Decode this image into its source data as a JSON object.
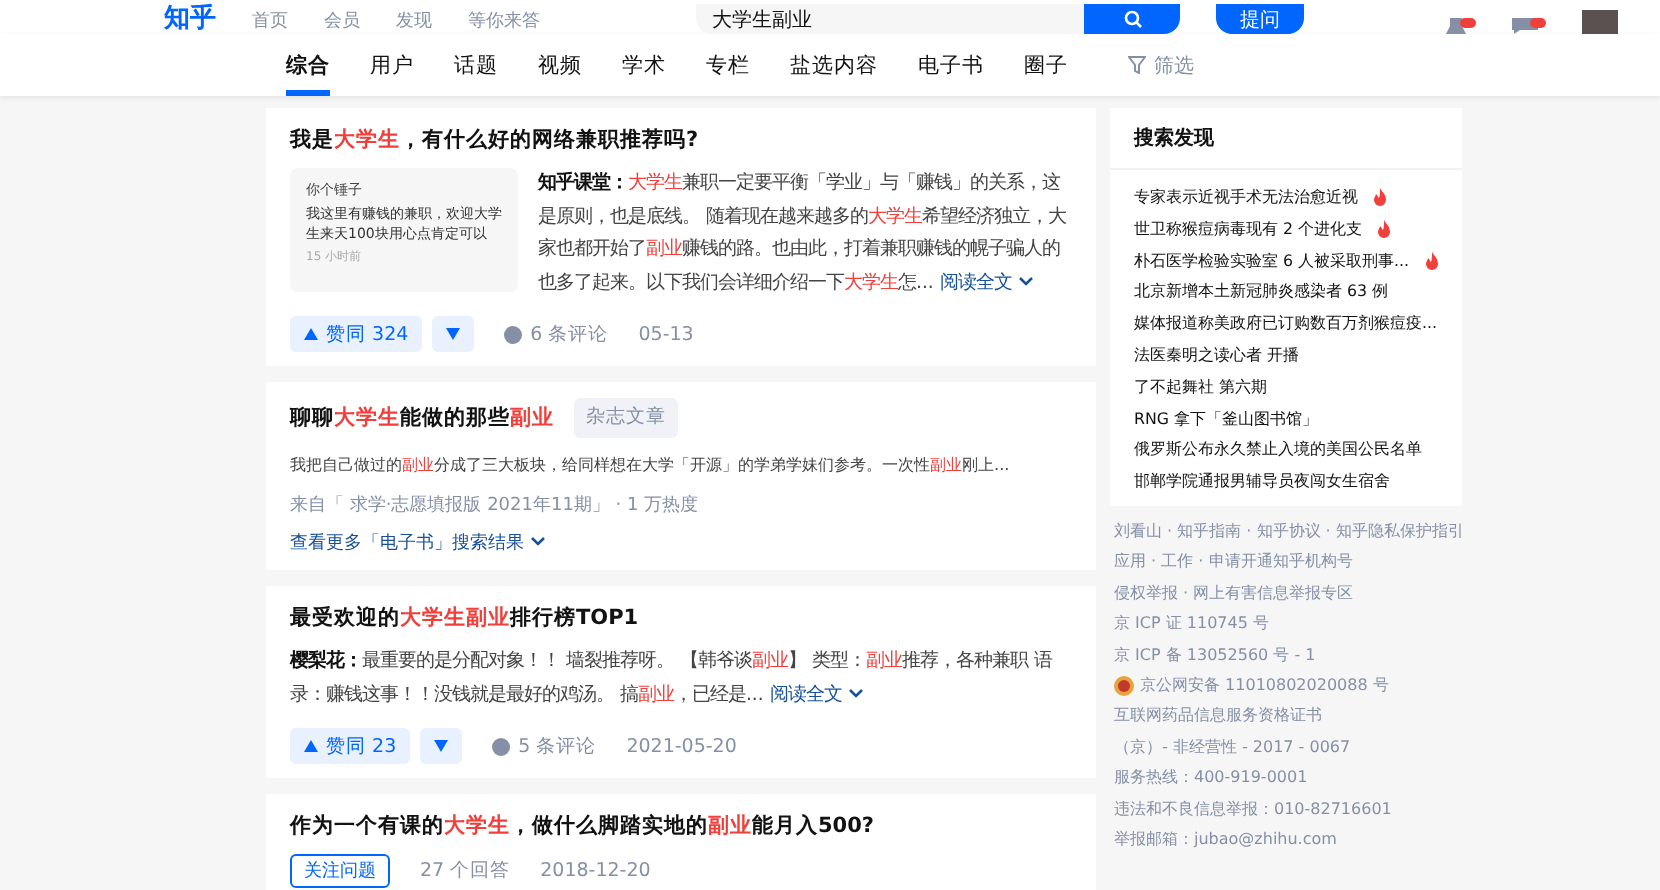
{
  "header": {
    "logo": "知乎",
    "nav": [
      {
        "label": "首页",
        "selected": false
      },
      {
        "label": "会员",
        "selected": false
      },
      {
        "label": "发现",
        "selected": false
      },
      {
        "label": "等你来答",
        "selected": false
      }
    ],
    "search": {
      "value": "大学生副业"
    },
    "ask_button": "提问"
  },
  "tabs": [
    {
      "label": "综合",
      "selected": true
    },
    {
      "label": "用户",
      "selected": false
    },
    {
      "label": "话题",
      "selected": false
    },
    {
      "label": "视频",
      "selected": false
    },
    {
      "label": "学术",
      "selected": false
    },
    {
      "label": "专栏",
      "selected": false
    },
    {
      "label": "盐选内容",
      "selected": false
    },
    {
      "label": "电子书",
      "selected": false
    },
    {
      "label": "圈子",
      "selected": false
    }
  ],
  "filter": "筛选",
  "results": [
    {
      "kind": "answer",
      "title": [
        {
          "text": "我是",
          "highlight": false
        },
        {
          "text": "大学生",
          "highlight": true
        },
        {
          "text": "，有什么好的网络兼职推荐吗?",
          "highlight": false
        }
      ],
      "thumbnail": {
        "name": "你个锤子",
        "text": "我这里有赚钱的兼职，欢迎大学生来天100块用心点肯定可以",
        "time": "15 小时前"
      },
      "author": "知乎课堂：",
      "excerpt": [
        {
          "text": "大学生",
          "highlight": true
        },
        {
          "text": "兼职一定要平衡「学业」与「赚钱」的关系，这是原则，也是底线。 随着现在越来越多的",
          "highlight": false
        },
        {
          "text": "大学生",
          "highlight": true
        },
        {
          "text": "希望经济独立，大家也都开始了",
          "highlight": false
        },
        {
          "text": "副业",
          "highlight": true
        },
        {
          "text": "赚钱的路。也由此，打着兼职赚钱的幌子骗人的也多了起来。以下我们会详细介绍一下",
          "highlight": false
        },
        {
          "text": "大学生",
          "highlight": true
        },
        {
          "text": "怎...",
          "highlight": false
        }
      ],
      "read_more": "阅读全文",
      "vote": "赞同 324",
      "comments": "6 条评论",
      "date": "05-13"
    },
    {
      "kind": "article",
      "title": [
        {
          "text": "聊聊",
          "highlight": false
        },
        {
          "text": "大学生",
          "highlight": true
        },
        {
          "text": "能做的那些",
          "highlight": false
        },
        {
          "text": "副业",
          "highlight": true
        }
      ],
      "tag": "杂志文章",
      "excerpt": [
        {
          "text": "我把自己做过的",
          "highlight": false
        },
        {
          "text": "副业",
          "highlight": true
        },
        {
          "text": "分成了三大板块，给同样想在大学「开源」的学弟学妹们参考。一次性",
          "highlight": false
        },
        {
          "text": "副业",
          "highlight": true
        },
        {
          "text": "刚上...",
          "highlight": false
        }
      ],
      "source": "来自「 求学·志愿填报版 2021年11期」 · 1 万热度",
      "more_link": "查看更多「电子书」搜索结果"
    },
    {
      "kind": "answer",
      "title": [
        {
          "text": "最受欢迎的",
          "highlight": false
        },
        {
          "text": "大学生副业",
          "highlight": true
        },
        {
          "text": "排行榜TOP1",
          "highlight": false
        }
      ],
      "author": "樱梨花：",
      "excerpt": [
        {
          "text": "最重要的是分配对象！！ 墙裂推荐呀。 【韩爷谈",
          "highlight": false
        },
        {
          "text": "副业",
          "highlight": true
        },
        {
          "text": "】 类型：",
          "highlight": false
        },
        {
          "text": "副业",
          "highlight": true
        },
        {
          "text": "推荐，各种兼职 语录：赚钱这事！！没钱就是最好的鸡汤。 搞",
          "highlight": false
        },
        {
          "text": "副业",
          "highlight": true
        },
        {
          "text": "，已经是...",
          "highlight": false
        }
      ],
      "read_more": "阅读全文",
      "vote": "赞同 23",
      "comments": "5 条评论",
      "date": "2021-05-20"
    },
    {
      "kind": "question",
      "title": [
        {
          "text": "作为一个有课的",
          "highlight": false
        },
        {
          "text": "大学生",
          "highlight": true
        },
        {
          "text": "，做什么脚踏实地的",
          "highlight": false
        },
        {
          "text": "副业",
          "highlight": true
        },
        {
          "text": "能月入500?",
          "highlight": false
        }
      ],
      "follow_button": "关注问题",
      "answers": "27 个回答",
      "date": "2018-12-20"
    }
  ],
  "sidebar": {
    "title": "搜索发现",
    "items": [
      {
        "text": "专家表示近视手术无法治愈近视",
        "hot": true
      },
      {
        "text": "世卫称猴痘病毒现有 2 个进化支",
        "hot": true
      },
      {
        "text": "朴石医学检验实验室 6 人被采取刑事...",
        "hot": true
      },
      {
        "text": "北京新增本土新冠肺炎感染者 63 例",
        "hot": false
      },
      {
        "text": "媒体报道称美政府已订购数百万剂猴痘疫...",
        "hot": false
      },
      {
        "text": "法医秦明之读心者 开播",
        "hot": false
      },
      {
        "text": "了不起舞社 第六期",
        "hot": false
      },
      {
        "text": "RNG 拿下「釜山图书馆」",
        "hot": false
      },
      {
        "text": "俄罗斯公布永久禁止入境的美国公民名单",
        "hot": false
      },
      {
        "text": "邯郸学院通报男辅导员夜闯女生宿舍",
        "hot": false
      }
    ]
  },
  "footer": [
    {
      "kind": "text",
      "text": "刘看山 · 知乎指南 · 知乎协议 · 知乎隐私保护指引"
    },
    {
      "kind": "text",
      "text": "应用 · 工作 · 申请开通知乎机构号"
    },
    {
      "kind": "text",
      "text": "侵权举报 · 网上有害信息举报专区"
    },
    {
      "kind": "text",
      "text": "京 ICP 证 110745 号"
    },
    {
      "kind": "text",
      "text": "京 ICP 备 13052560 号 - 1"
    },
    {
      "kind": "police",
      "text": "京公网安备 11010802020088 号"
    },
    {
      "kind": "text",
      "text": "互联网药品信息服务资格证书"
    },
    {
      "kind": "text",
      "text": "（京）- 非经营性 - 2017 - 0067"
    },
    {
      "kind": "text",
      "text": "服务热线：400-919-0001"
    },
    {
      "kind": "text",
      "text": "违法和不良信息举报：010-82716601"
    },
    {
      "kind": "text",
      "text": "举报邮箱：jubao@zhihu.com"
    }
  ]
}
